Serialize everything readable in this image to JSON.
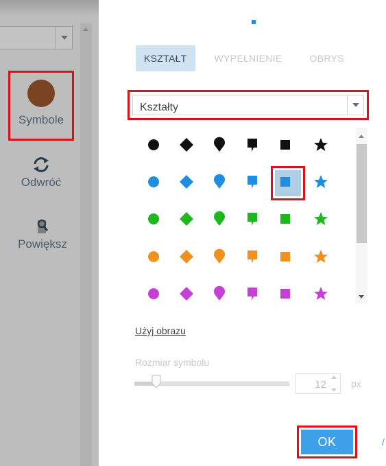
{
  "sidebar": {
    "tools": [
      {
        "label": "Symbole",
        "icon": "brown-circle-icon",
        "color": "#7a4422"
      },
      {
        "label": "Odwróć",
        "icon": "refresh-icon"
      },
      {
        "label": "Powiększ",
        "icon": "zoom-icon"
      }
    ]
  },
  "tabs": [
    {
      "label": "KSZTAŁT",
      "active": true
    },
    {
      "label": "WYPEŁNIENIE",
      "active": false
    },
    {
      "label": "OBRYS",
      "active": false
    }
  ],
  "shapes_select": {
    "value": "Kształty"
  },
  "symbol_grid": {
    "rows": [
      {
        "color": "#111111",
        "shapes": [
          "circle",
          "diamond",
          "pin",
          "callout",
          "square",
          "star"
        ]
      },
      {
        "color": "#1e8fe0",
        "shapes": [
          "circle",
          "diamond",
          "pin",
          "callout",
          "square",
          "star"
        ]
      },
      {
        "color": "#1eb81e",
        "shapes": [
          "circle",
          "diamond",
          "pin",
          "callout",
          "square",
          "star"
        ]
      },
      {
        "color": "#f0901e",
        "shapes": [
          "circle",
          "diamond",
          "pin",
          "callout",
          "square",
          "star"
        ]
      },
      {
        "color": "#c640d8",
        "shapes": [
          "circle",
          "diamond",
          "pin",
          "callout",
          "square",
          "star"
        ]
      }
    ],
    "selected": "blue square"
  },
  "use_image_link": "Użyj obrazu",
  "symbol_size": {
    "label": "Rozmiar symbolu",
    "value": "12",
    "unit": "px"
  },
  "ok_button": "OK",
  "colors": {
    "accent": "#3da0e8",
    "highlight": "#e0101a",
    "tab_active_bg": "#cfe3f3"
  }
}
